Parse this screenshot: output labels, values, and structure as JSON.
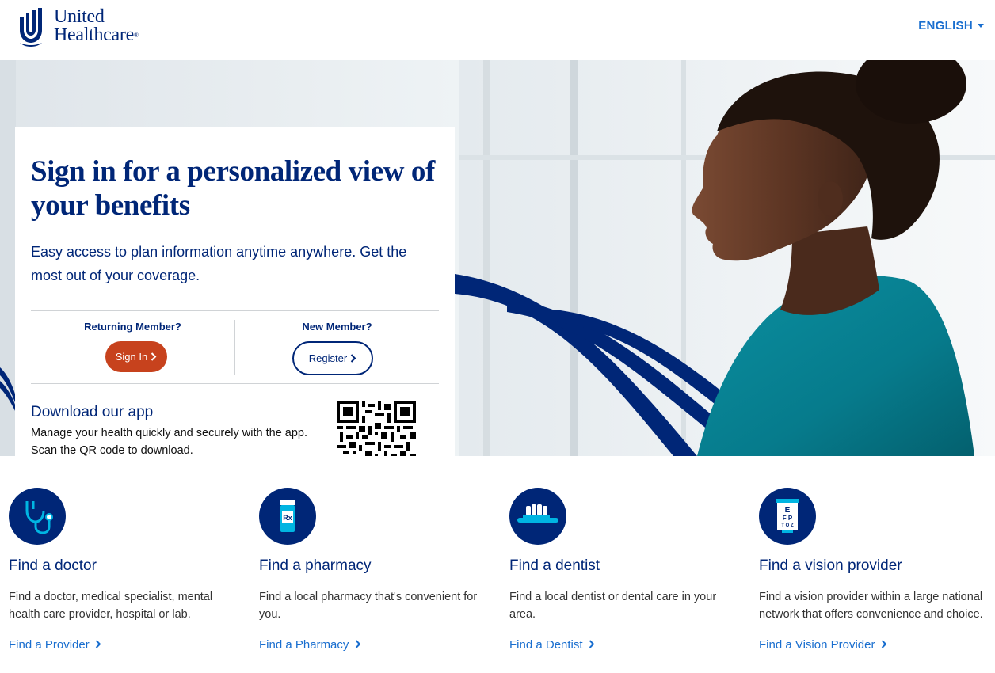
{
  "header": {
    "logo_line1": "United",
    "logo_line2": "Healthcare",
    "logo_mark_symbol": "®",
    "language": "ENGLISH"
  },
  "hero": {
    "headline": "Sign in for a personalized view of your benefits",
    "subtext": "Easy access to plan information anytime anywhere. Get the most out of your coverage.",
    "returning_label": "Returning Member?",
    "signin_button": "Sign In",
    "new_label": "New Member?",
    "register_button": "Register",
    "app_title": "Download our app",
    "app_text_line1": "Manage your health quickly and securely with the app.",
    "app_text_line2": "Scan the QR code to download."
  },
  "features": [
    {
      "icon": "stethoscope-icon",
      "title": "Find a doctor",
      "description": "Find a doctor, medical specialist, mental health care provider, hospital or lab.",
      "link": "Find a Provider"
    },
    {
      "icon": "pharmacy-bottle-icon",
      "title": "Find a pharmacy",
      "description": "Find a local pharmacy that's convenient for you.",
      "link": "Find a Pharmacy"
    },
    {
      "icon": "toothbrush-icon",
      "title": "Find a dentist",
      "description": "Find a local dentist or dental care in your area.",
      "link": "Find a Dentist"
    },
    {
      "icon": "eye-chart-icon",
      "title": "Find a vision provider",
      "description": "Find a vision provider within a large national network that offers convenience and choice.",
      "link": "Find a Vision Provider"
    }
  ],
  "colors": {
    "brand_navy": "#002677",
    "link_blue": "#196ecf",
    "signin_orange": "#c7421d",
    "icon_accent": "#00b5e2"
  }
}
